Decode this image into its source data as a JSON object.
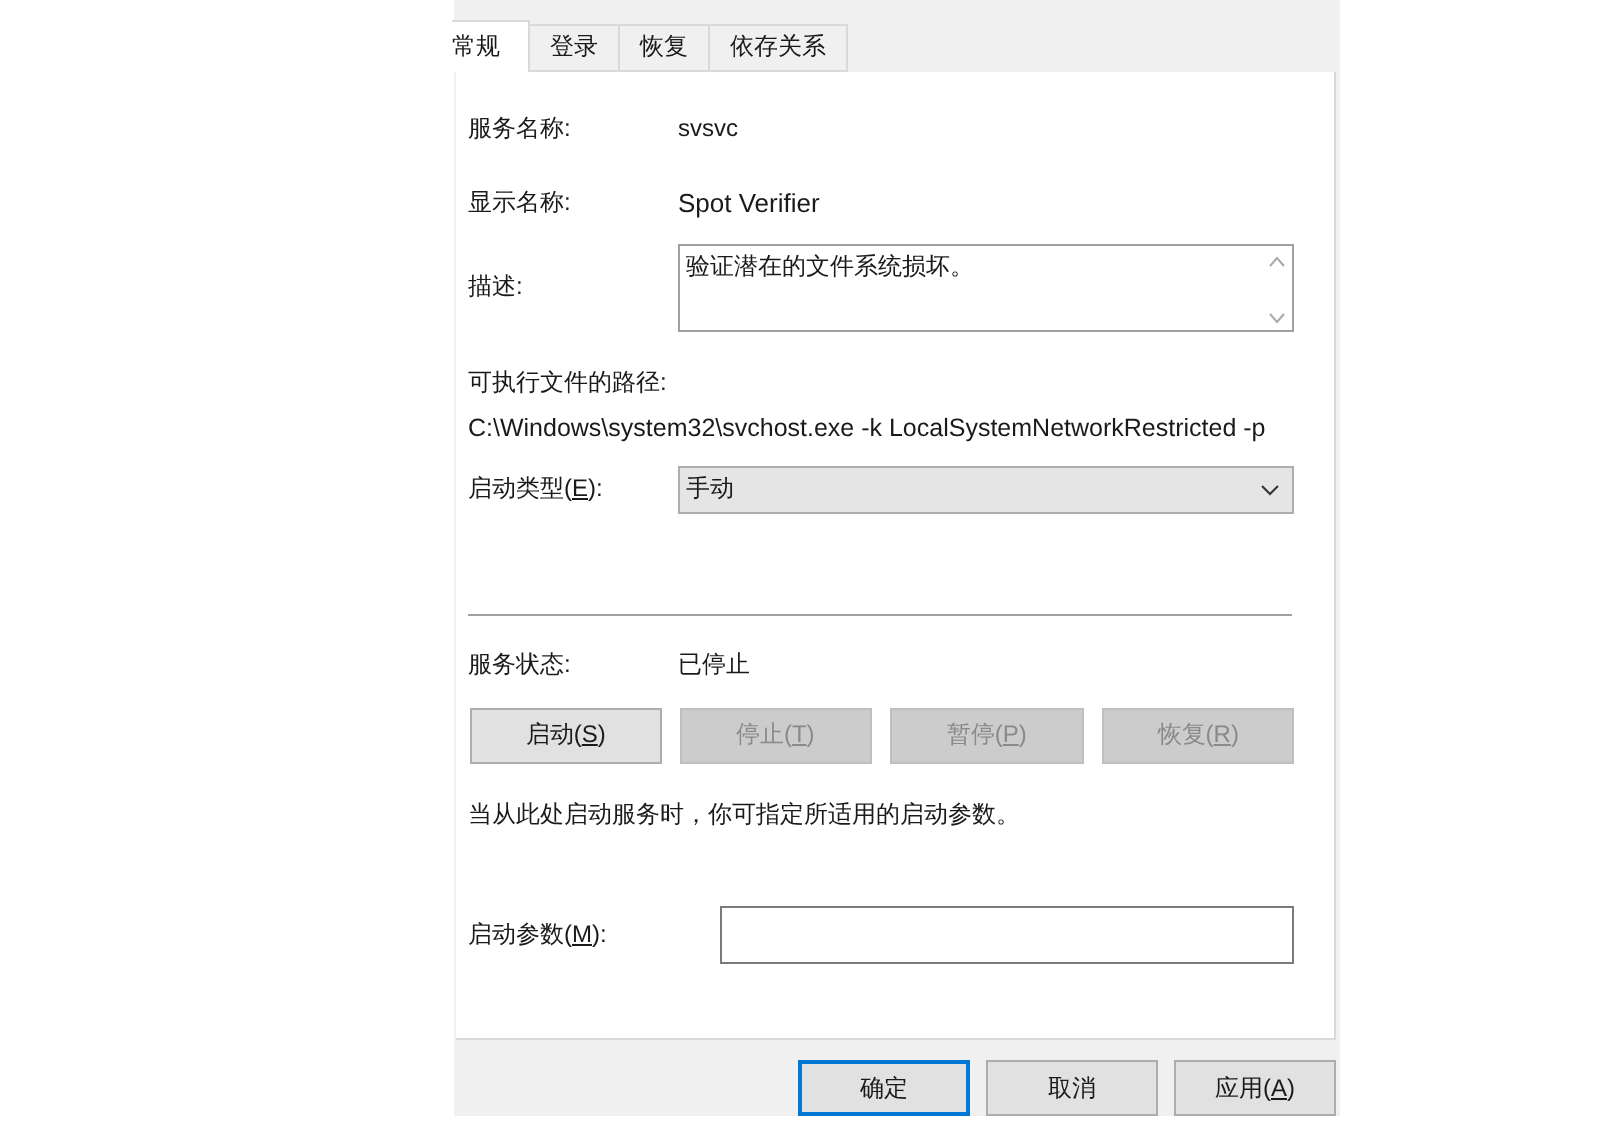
{
  "tabs": [
    {
      "label": "常规",
      "selected": true
    },
    {
      "label": "登录",
      "selected": false
    },
    {
      "label": "恢复",
      "selected": false
    },
    {
      "label": "依存关系",
      "selected": false
    }
  ],
  "service_name": {
    "label": "服务名称:",
    "value": "svsvc"
  },
  "display_name": {
    "label": "显示名称:",
    "value": "Spot Verifier"
  },
  "description": {
    "label": "描述:",
    "value": "验证潜在的文件系统损坏。"
  },
  "executable_path": {
    "label": "可执行文件的路径:",
    "value": "C:\\Windows\\system32\\svchost.exe -k LocalSystemNetworkRestricted -p"
  },
  "startup_type": {
    "label": [
      "启动类型(",
      "E",
      "):"
    ],
    "value": "手动"
  },
  "service_status": {
    "label": "服务状态:",
    "value": "已停止"
  },
  "control_buttons": [
    {
      "label": [
        "启动(",
        "S",
        ")"
      ],
      "disabled": false
    },
    {
      "label": [
        "停止(",
        "T",
        ")"
      ],
      "disabled": true
    },
    {
      "label": [
        "暂停(",
        "P",
        ")"
      ],
      "disabled": true
    },
    {
      "label": [
        "恢复(",
        "R",
        ")"
      ],
      "disabled": true
    }
  ],
  "hint": "当从此处启动服务时，你可指定所适用的启动参数。",
  "start_parameters": {
    "label": [
      "启动参数(",
      "M",
      "):"
    ]
  },
  "dialog_buttons": [
    {
      "label": [
        "确定"
      ],
      "default": true
    },
    {
      "label": [
        "取消"
      ],
      "default": false
    },
    {
      "label": [
        "应用(",
        "A",
        ")"
      ],
      "default": false
    }
  ]
}
